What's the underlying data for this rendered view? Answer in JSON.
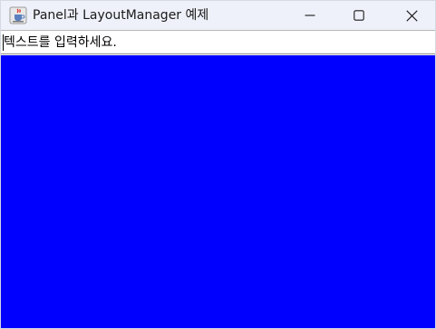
{
  "window": {
    "title": "Panel과 LayoutManager 예제",
    "app_icon": "java-cup-icon"
  },
  "caption_buttons": {
    "minimize_icon": "minimize-icon",
    "maximize_icon": "maximize-icon",
    "close_icon": "close-icon"
  },
  "text_field": {
    "value": "텍스트를 입력하세요."
  },
  "panel": {
    "color": "#0000ff"
  },
  "colors": {
    "titlebar": "#eef1f9",
    "panel": "#0000ff",
    "text": "#000000"
  }
}
